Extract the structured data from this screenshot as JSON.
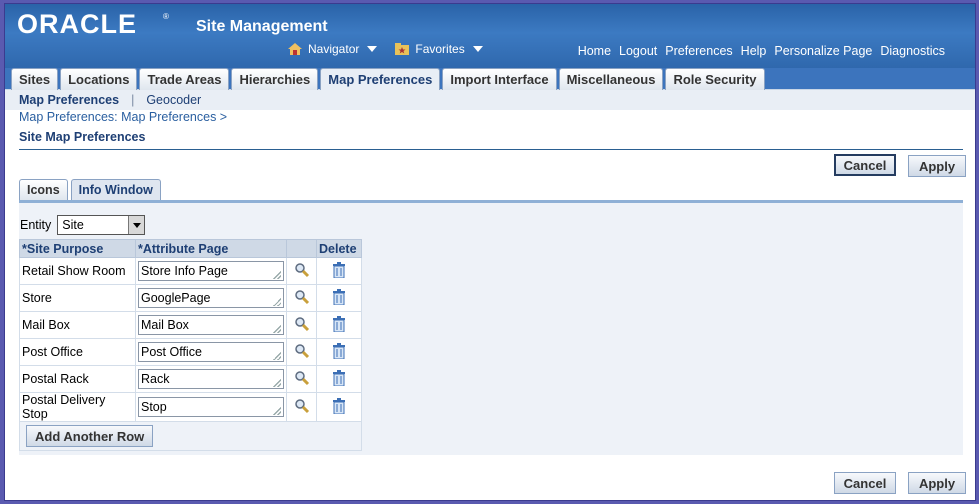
{
  "brand": {
    "logo": "ORACLE",
    "reg": "®",
    "app_title": "Site Management"
  },
  "global_nav": {
    "navigator": "Navigator",
    "favorites": "Favorites"
  },
  "global_links": [
    "Home",
    "Logout",
    "Preferences",
    "Help",
    "Personalize Page",
    "Diagnostics"
  ],
  "main_tabs": [
    {
      "label": "Sites"
    },
    {
      "label": "Locations"
    },
    {
      "label": "Trade Areas"
    },
    {
      "label": "Hierarchies"
    },
    {
      "label": "Map Preferences",
      "active": true
    },
    {
      "label": "Import Interface"
    },
    {
      "label": "Miscellaneous"
    },
    {
      "label": "Role Security"
    }
  ],
  "sub_tabs": {
    "active": "Map Preferences",
    "other": "Geocoder"
  },
  "breadcrumb": "Map Preferences: Map Preferences  >",
  "page_title": "Site Map Preferences",
  "buttons": {
    "cancel": "Cancel",
    "apply": "Apply",
    "add_row": "Add Another Row"
  },
  "inner_tabs": [
    {
      "label": "Icons"
    },
    {
      "label": "Info Window",
      "active": true
    }
  ],
  "entity": {
    "label": "Entity",
    "value": "Site"
  },
  "table": {
    "headers": {
      "purpose": "*Site Purpose",
      "attribute": "*Attribute Page",
      "delete": "Delete"
    },
    "rows": [
      {
        "purpose": "Retail Show Room",
        "attribute": "Store Info Page"
      },
      {
        "purpose": "Store",
        "attribute": "GooglePage"
      },
      {
        "purpose": "Mail Box",
        "attribute": "Mail Box"
      },
      {
        "purpose": "Post Office",
        "attribute": "Post Office"
      },
      {
        "purpose": "Postal Rack",
        "attribute": "Rack"
      },
      {
        "purpose": "Postal Delivery Stop",
        "attribute": "Stop"
      }
    ]
  },
  "colors": {
    "header": "#2f68ad",
    "tabbar": "#3c74bd",
    "link": "#2a5fa0",
    "title": "#1e3f74"
  }
}
